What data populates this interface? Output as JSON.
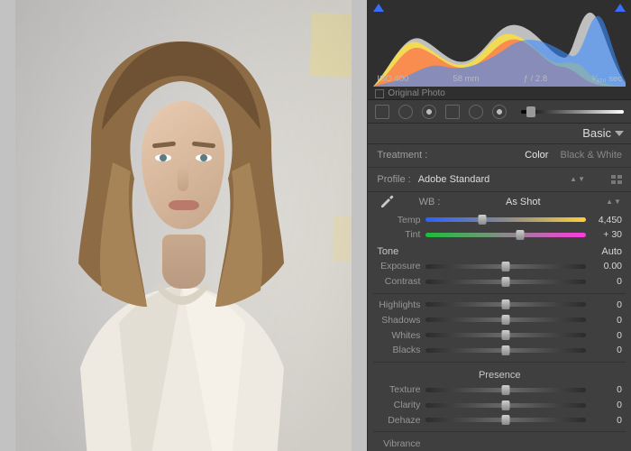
{
  "histogram": {
    "clip_left": "triangle-icon",
    "clip_right": "triangle-icon",
    "meta": {
      "iso": "ISO 400",
      "focal": "58 mm",
      "aperture": "ƒ / 2.8",
      "shutter": "¹⁄₃₂₀ sec"
    },
    "original_photo_label": "Original Photo"
  },
  "panel_title": "Basic",
  "treatment": {
    "label": "Treatment :",
    "options": [
      "Color",
      "Black & White"
    ],
    "selected": "Color"
  },
  "profile": {
    "label": "Profile :",
    "value": "Adobe Standard"
  },
  "wb": {
    "label": "WB :",
    "value": "As Shot"
  },
  "temp": {
    "label": "Temp",
    "value": "4,450",
    "pos": 35
  },
  "tint": {
    "label": "Tint",
    "value": "+ 30",
    "pos": 59
  },
  "tone": {
    "header": "Tone",
    "auto": "Auto",
    "exposure": {
      "label": "Exposure",
      "value": "0.00",
      "pos": 50
    },
    "contrast": {
      "label": "Contrast",
      "value": "0",
      "pos": 50
    },
    "highlights": {
      "label": "Highlights",
      "value": "0",
      "pos": 50
    },
    "shadows": {
      "label": "Shadows",
      "value": "0",
      "pos": 50
    },
    "whites": {
      "label": "Whites",
      "value": "0",
      "pos": 50
    },
    "blacks": {
      "label": "Blacks",
      "value": "0",
      "pos": 50
    }
  },
  "presence": {
    "header": "Presence",
    "texture": {
      "label": "Texture",
      "value": "0",
      "pos": 50
    },
    "clarity": {
      "label": "Clarity",
      "value": "0",
      "pos": 50
    },
    "dehaze": {
      "label": "Dehaze",
      "value": "0",
      "pos": 50
    }
  },
  "vibrance_header": "Vibrance"
}
